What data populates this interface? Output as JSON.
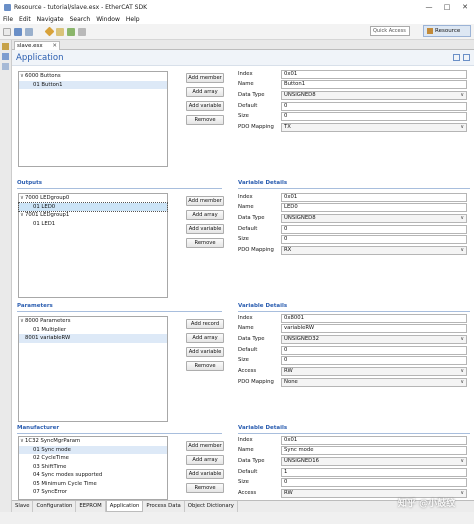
{
  "window": {
    "title": "Resource - tutorial/slave.esx - EtherCAT SDK",
    "minimize": "—",
    "maximize": "□",
    "close": "✕"
  },
  "menu": [
    "File",
    "Edit",
    "Navigate",
    "Search",
    "Window",
    "Help"
  ],
  "toolbar": {
    "quick_access": "Quick Access",
    "perspective": "Resource"
  },
  "editor_tab": {
    "label": "slave.esx",
    "close": "✕"
  },
  "page": {
    "title": "Application"
  },
  "buttons": {
    "add_member": "Add member",
    "add_array": "Add array",
    "add_variable": "Add variable",
    "remove": "Remove",
    "add_record": "Add record"
  },
  "inputs": {
    "tree": [
      {
        "toggle": "∨",
        "label": "6000  Buttons"
      },
      {
        "toggle": "",
        "label": "01  Button1"
      }
    ],
    "props": [
      {
        "label": "Index",
        "value": "0x01",
        "dropdown": false
      },
      {
        "label": "Name",
        "value": "Button1",
        "dropdown": false
      },
      {
        "label": "Data Type",
        "value": "UNSIGNED8",
        "dropdown": true
      },
      {
        "label": "Default",
        "value": "0",
        "dropdown": false
      },
      {
        "label": "Size",
        "value": "0",
        "dropdown": false
      },
      {
        "label": "PDO Mapping",
        "value": "TX",
        "dropdown": true
      }
    ]
  },
  "outputs": {
    "title": "Outputs",
    "details_title": "Variable Details",
    "tree": [
      {
        "toggle": "∨",
        "label": "7000  LEDgroup0"
      },
      {
        "toggle": "",
        "label": "01  LED0"
      },
      {
        "toggle": "∨",
        "label": "7001  LEDgroup1"
      },
      {
        "toggle": "",
        "label": "01  LED1"
      }
    ],
    "props": [
      {
        "label": "Index",
        "value": "0x01",
        "dropdown": false
      },
      {
        "label": "Name",
        "value": "LED0",
        "dropdown": false
      },
      {
        "label": "Data Type",
        "value": "UNSIGNED8",
        "dropdown": true
      },
      {
        "label": "Default",
        "value": "0",
        "dropdown": false
      },
      {
        "label": "Size",
        "value": "0",
        "dropdown": false
      },
      {
        "label": "PDO Mapping",
        "value": "RX",
        "dropdown": true
      }
    ]
  },
  "parameters": {
    "title": "Parameters",
    "details_title": "Variable Details",
    "tree": [
      {
        "toggle": "∨",
        "label": "8000  Parameters"
      },
      {
        "toggle": "",
        "label": "01  Multiplier"
      },
      {
        "toggle": "",
        "label": "8001  variableRW"
      }
    ],
    "props": [
      {
        "label": "Index",
        "value": "0x8001",
        "dropdown": false
      },
      {
        "label": "Name",
        "value": "variableRW",
        "dropdown": false
      },
      {
        "label": "Data Type",
        "value": "UNSIGNED32",
        "dropdown": true
      },
      {
        "label": "Default",
        "value": "0",
        "dropdown": false
      },
      {
        "label": "Size",
        "value": "0",
        "dropdown": false
      },
      {
        "label": "Access",
        "value": "RW",
        "dropdown": true
      },
      {
        "label": "PDO Mapping",
        "value": "None",
        "dropdown": true
      }
    ]
  },
  "manufacturer": {
    "title": "Manufacturer",
    "details_title": "Variable Details",
    "tree": [
      {
        "toggle": "∨",
        "label": "1C32  SyncMgrParam"
      },
      {
        "toggle": "",
        "label": "01  Sync mode"
      },
      {
        "toggle": "",
        "label": "02  CycleTime"
      },
      {
        "toggle": "",
        "label": "03  ShiftTime"
      },
      {
        "toggle": "",
        "label": "04  Sync modes supported"
      },
      {
        "toggle": "",
        "label": "05  Minimum Cycle Time"
      },
      {
        "toggle": "",
        "label": "07  SyncError"
      }
    ],
    "props": [
      {
        "label": "Index",
        "value": "0x01",
        "dropdown": false
      },
      {
        "label": "Name",
        "value": "Sync mode",
        "dropdown": false
      },
      {
        "label": "Data Type",
        "value": "UNSIGNED16",
        "dropdown": true
      },
      {
        "label": "Default",
        "value": "1",
        "dropdown": false
      },
      {
        "label": "Size",
        "value": "0",
        "dropdown": false
      },
      {
        "label": "Access",
        "value": "RW",
        "dropdown": true
      }
    ]
  },
  "bottom_tabs": [
    "Slave",
    "Configuration",
    "EEPROM",
    "Application",
    "Process Data",
    "Object Dictionary"
  ],
  "watermark": "知乎 @小鼓纹",
  "colors": {
    "accent": "#2a5db0",
    "selection": "#dde9f7"
  }
}
